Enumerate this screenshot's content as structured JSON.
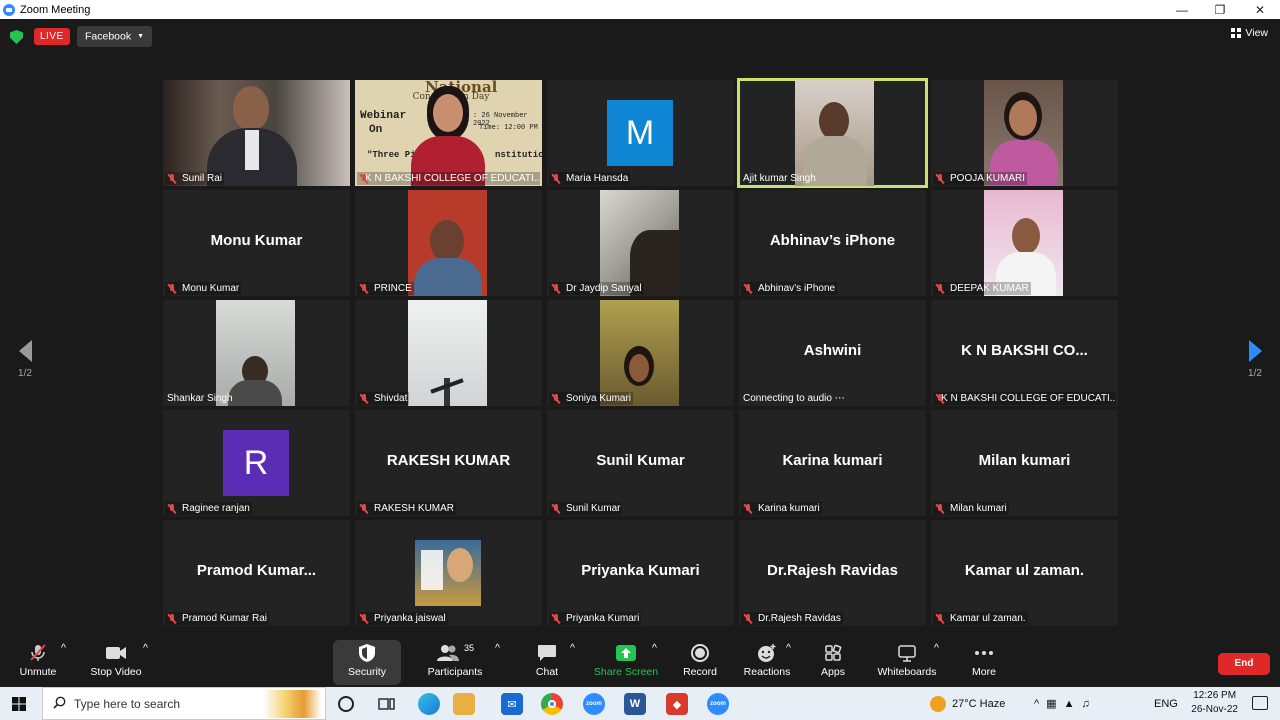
{
  "window": {
    "title": "Zoom Meeting"
  },
  "topbar": {
    "live_label": "LIVE",
    "stream_target": "Facebook",
    "view_label": "View"
  },
  "pagination": {
    "left_page": "1/2",
    "right_page": "1/2"
  },
  "tiles": [
    {
      "id": "t1",
      "label": "Sunil Rai",
      "kind": "video",
      "bg": "#4a3f38"
    },
    {
      "id": "t2",
      "label": "K N BAKSHI COLLEGE OF EDUCATI...",
      "kind": "video",
      "bg": "#d8c9a0"
    },
    {
      "id": "t3",
      "label": "Maria Hansda",
      "kind": "avatar",
      "letter": "M",
      "avatar_color": "#0e86d4"
    },
    {
      "id": "t4",
      "label": "Ajit kumar Singh",
      "kind": "video",
      "bg": "#b8b0a8",
      "active": true
    },
    {
      "id": "t5",
      "label": "POOJA KUMARI",
      "kind": "video",
      "bg": "#7a6660"
    },
    {
      "id": "t6",
      "label": "Monu Kumar",
      "kind": "name",
      "big": "Monu Kumar"
    },
    {
      "id": "t7",
      "label": "PRINCE",
      "kind": "video",
      "bg": "#b83a2a"
    },
    {
      "id": "t8",
      "label": "Dr Jaydip Sanyal",
      "kind": "video",
      "bg": "#8a8a80"
    },
    {
      "id": "t9",
      "label": "Abhinav’s iPhone",
      "kind": "name",
      "big": "Abhinav’s iPhone"
    },
    {
      "id": "t10",
      "label": "DEEPAK KUMAR",
      "kind": "video",
      "bg": "#d8b8c8"
    },
    {
      "id": "t11",
      "label": "Shankar Singh",
      "kind": "video",
      "bg": "#c8ccc8",
      "no_mic": true
    },
    {
      "id": "t12",
      "label": "Shivdat",
      "kind": "video",
      "bg": "#e0e2e2"
    },
    {
      "id": "t13",
      "label": "Soniya Kumari",
      "kind": "video",
      "bg": "#9a8a40"
    },
    {
      "id": "t14",
      "label": "Connecting to audio ⋯",
      "kind": "name",
      "big": "Ashwini",
      "no_mic": true
    },
    {
      "id": "t15",
      "label": "K N BAKSHI COLLEGE OF EDUCATI...",
      "kind": "name",
      "big": "K N BAKSHI CO..."
    },
    {
      "id": "t16",
      "label": "Raginee ranjan",
      "kind": "avatar",
      "letter": "R",
      "avatar_color": "#5b2db4"
    },
    {
      "id": "t17",
      "label": "RAKESH KUMAR",
      "kind": "name",
      "big": "RAKESH KUMAR"
    },
    {
      "id": "t18",
      "label": "Sunil Kumar",
      "kind": "name",
      "big": "Sunil Kumar"
    },
    {
      "id": "t19",
      "label": "Karina kumari",
      "kind": "name",
      "big": "Karina kumari"
    },
    {
      "id": "t20",
      "label": "Milan kumari",
      "kind": "name",
      "big": "Milan kumari"
    },
    {
      "id": "t21",
      "label": "Pramod Kumar Rai",
      "kind": "name",
      "big": "Pramod  Kumar..."
    },
    {
      "id": "t22",
      "label": "Priyanka jaiswal",
      "kind": "image",
      "bg": "#2a5a8a"
    },
    {
      "id": "t23",
      "label": "Priyanka Kumari",
      "kind": "name",
      "big": "Priyanka Kumari"
    },
    {
      "id": "t24",
      "label": "Dr.Rajesh Ravidas",
      "kind": "name",
      "big": "Dr.Rajesh Ravidas"
    },
    {
      "id": "t25",
      "label": "Kamar ul zaman.",
      "kind": "name",
      "big": "Kamar ul zaman."
    }
  ],
  "webinar_poster": {
    "line1": "National",
    "line2": "Constitution Day",
    "line3": "Webinar",
    "line4": "On",
    "date": ": 26 November 2022",
    "time": "Time: 12:00 PM",
    "quote_start": "\"Three Pil",
    "quote_end": "nstitution"
  },
  "toolbar": {
    "unmute": "Unmute",
    "stop_video": "Stop Video",
    "security": "Security",
    "participants": "Participants",
    "participants_count": "35",
    "chat": "Chat",
    "share_screen": "Share Screen",
    "record": "Record",
    "reactions": "Reactions",
    "apps": "Apps",
    "whiteboards": "Whiteboards",
    "more": "More",
    "end": "End"
  },
  "taskbar": {
    "search_placeholder": "Type here to search",
    "weather": "27°C  Haze",
    "language": "ENG",
    "time": "12:26 PM",
    "date": "26-Nov-22"
  },
  "colors": {
    "accent_green": "#23c552",
    "live_red": "#e02828",
    "active_speaker": "#c9e26b",
    "zoom_blue": "#2d8cff"
  }
}
